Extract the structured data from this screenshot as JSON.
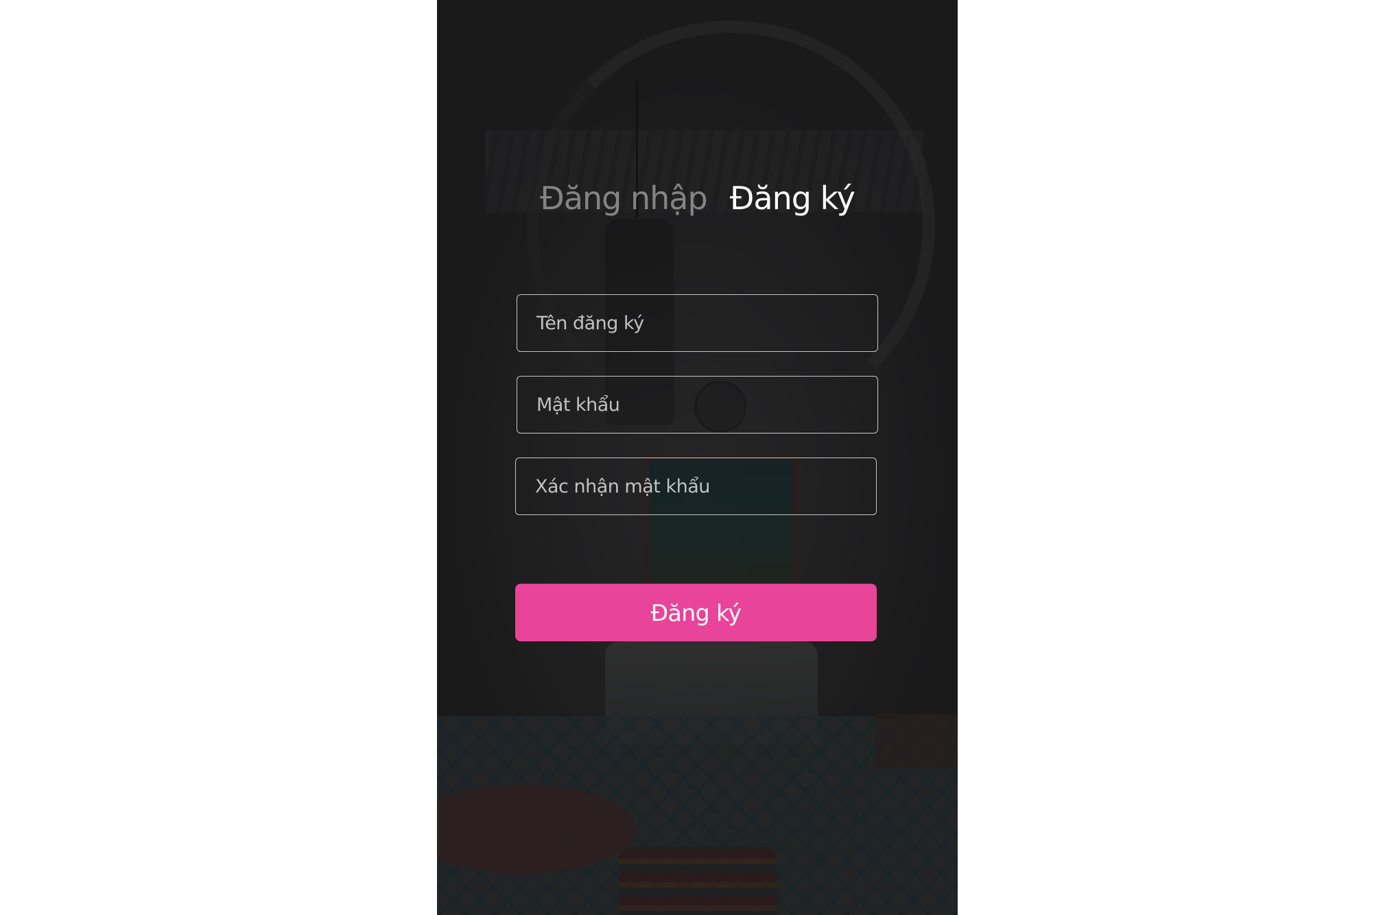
{
  "tabs": {
    "login_label": "Đăng nhập",
    "register_label": "Đăng ký",
    "active": "register"
  },
  "form": {
    "username_placeholder": "Tên đăng ký",
    "password_placeholder": "Mật khẩu",
    "confirm_password_placeholder": "Xác nhận mật khẩu",
    "submit_label": "Đăng ký"
  },
  "colors": {
    "accent": "#e8449a",
    "text": "#ffffff",
    "overlay": "#141416"
  }
}
